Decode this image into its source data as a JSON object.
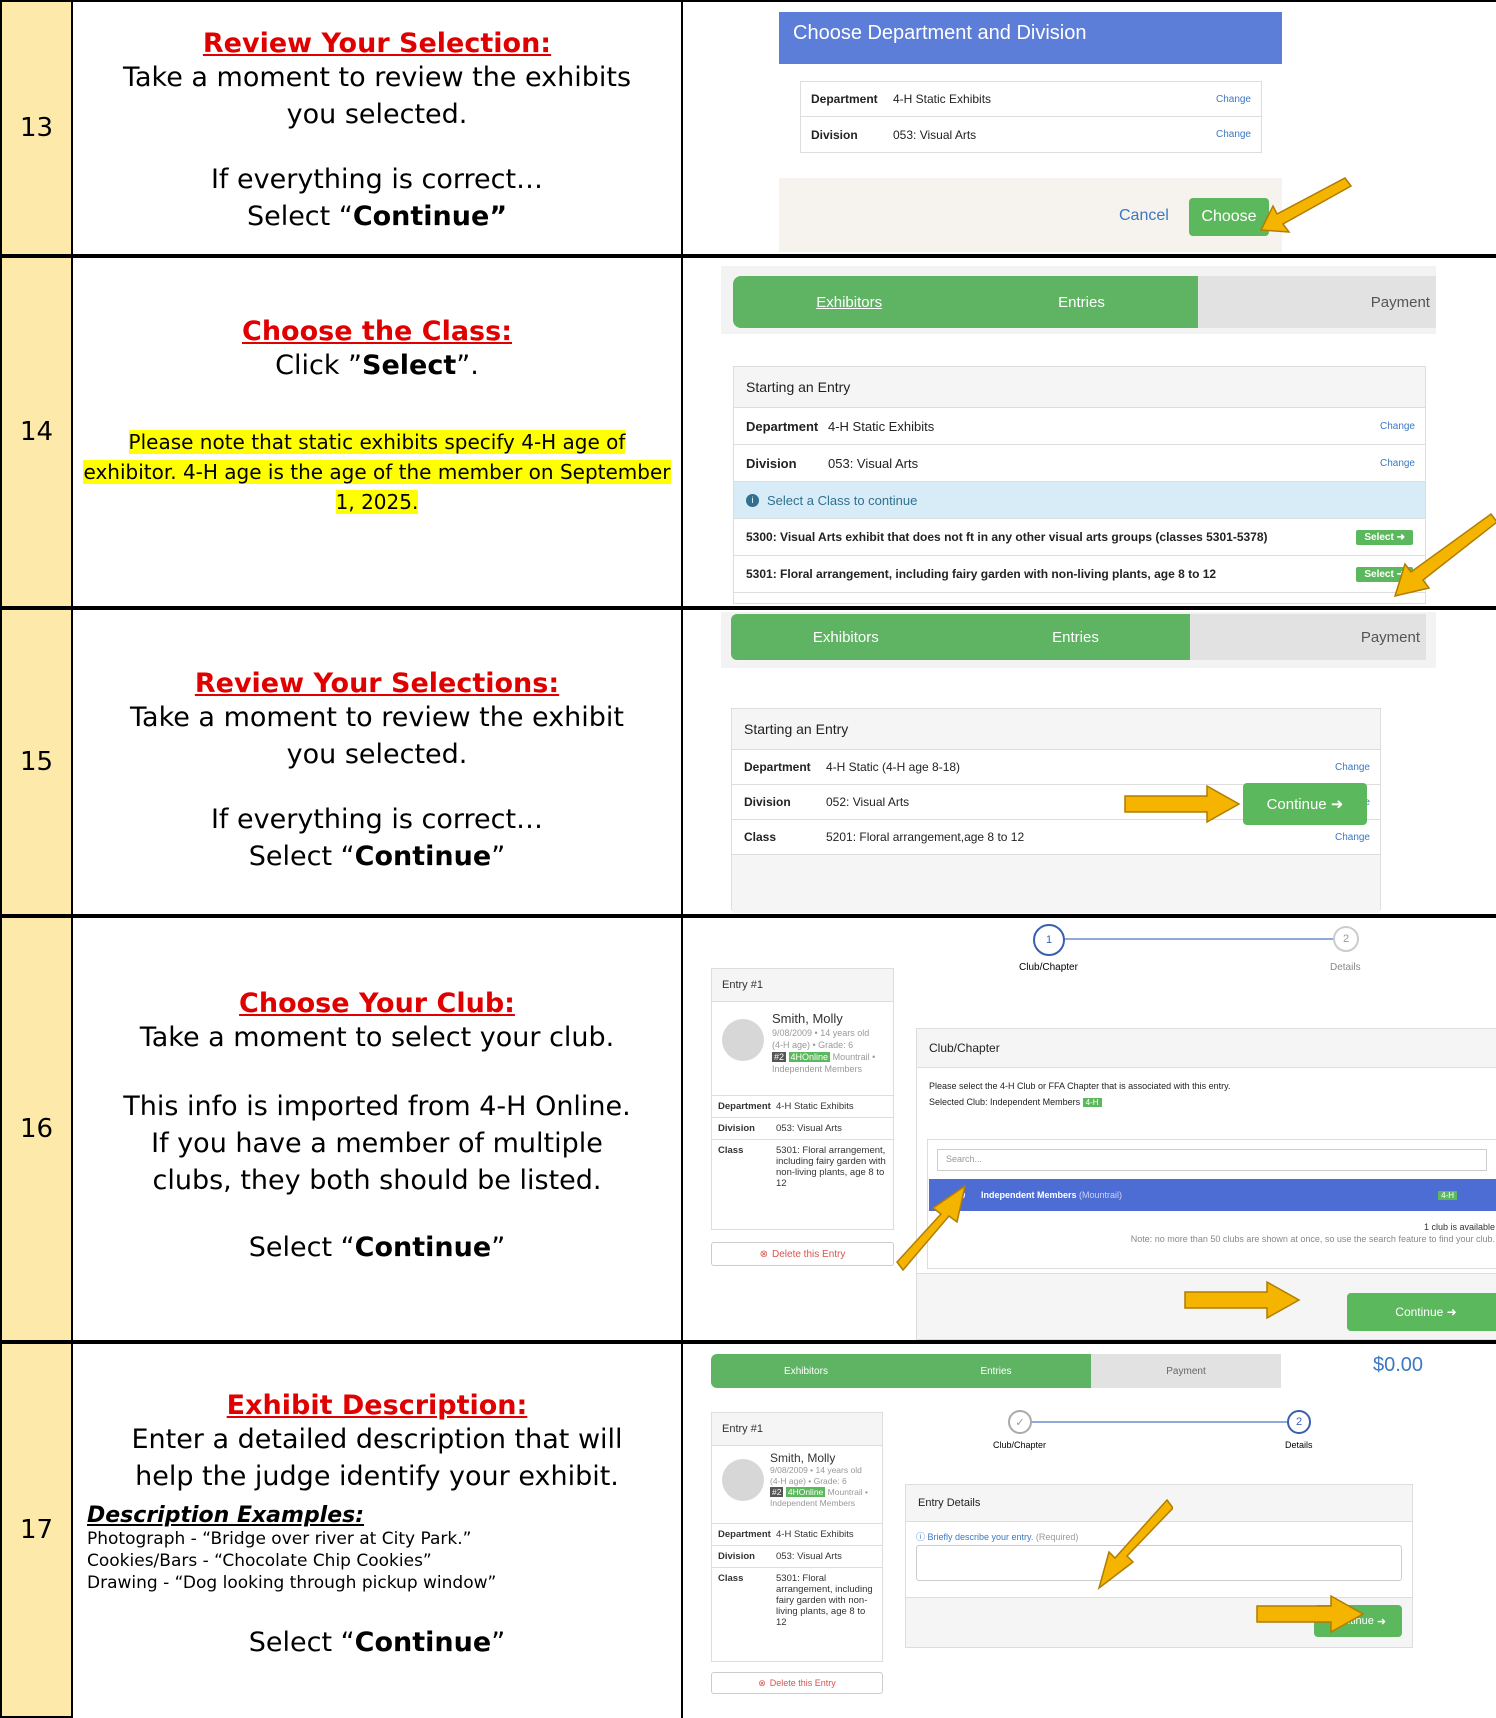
{
  "r13": {
    "num": "13",
    "heading": "Review Your Selection:",
    "l1": "Take a moment to review the exhibits",
    "l2": "you selected.",
    "l3": "If everything is correct…",
    "l4a": "Select “",
    "l4b": "Continue”",
    "ui": {
      "title": "Choose Department and Division",
      "dept_label": "Department",
      "dept_value": "4-H Static Exhibits",
      "div_label": "Division",
      "div_value": "053: Visual Arts",
      "change": "Change",
      "cancel": "Cancel",
      "choose": "Choose"
    }
  },
  "r14": {
    "num": "14",
    "heading": "Choose the Class:",
    "l1a": "Click ”",
    "l1b": "Select",
    "l1c": "”.",
    "note": "Please note that static exhibits specify 4-H age of exhibitor. 4-H age is the age  of the member on September 1, 2025.",
    "ui": {
      "step1": "Exhibitors",
      "step2": "Entries",
      "step3": "Payment",
      "panel_title": "Starting an Entry",
      "dept_label": "Department",
      "dept_value": "4-H Static Exhibits",
      "div_label": "Division",
      "div_value": "053: Visual Arts",
      "change": "Change",
      "info": "Select a Class to continue",
      "class1": "5300: Visual Arts exhibit that does not ft in any other visual arts groups (classes 5301-5378)",
      "class2": "5301: Floral arrangement, including fairy garden with non-living plants, age 8 to 12",
      "select": "Select"
    }
  },
  "r15": {
    "num": "15",
    "heading": "Review Your Selections:",
    "l1": "Take a moment to review the exhibit",
    "l2": "you selected.",
    "l3": "If everything is correct…",
    "l4a": "Select “",
    "l4b": "Continue",
    "l4c": "”",
    "ui": {
      "step1": "Exhibitors",
      "step2": "Entries",
      "step3": "Payment",
      "panel_title": "Starting an Entry",
      "dept_label": "Department",
      "dept_value": "4-H Static (4-H age 8-18)",
      "div_label": "Division",
      "div_value": "052: Visual Arts",
      "class_label": "Class",
      "class_value": "5201: Floral arrangement,age 8 to 12",
      "change": "Change",
      "continue": "Continue"
    }
  },
  "r16": {
    "num": "16",
    "heading": "Choose Your Club:",
    "l1": "Take a moment to select your club.",
    "l2": "This info is imported from 4-H Online.",
    "l3": "If you have a member of multiple",
    "l4": "clubs, they both should be listed.",
    "l5a": "Select “",
    "l5b": "Continue",
    "l5c": "”",
    "ui": {
      "entry": "Entry #1",
      "name": "Smith, Molly",
      "dob": "9/08/2009 • 14 years old",
      "age": "(4-H age) • Grade: 6",
      "badge_num": "#2",
      "badge": "4HOnline",
      "county": "Mountrail •",
      "club": "Independent Members",
      "dept_label": "Department",
      "dept_value": "4-H Static Exhibits",
      "div_label": "Division",
      "div_value": "053: Visual Arts",
      "class_label": "Class",
      "class_value": "5301: Floral arrangement, including fairy garden with non-living plants, age 8 to 12",
      "delete": "Delete this Entry",
      "step1_num": "1",
      "step1": "Club/Chapter",
      "step2_num": "2",
      "step2": "Details",
      "panel_title": "Club/Chapter",
      "prompt": "Please select the 4-H Club or FFA Chapter that is associated with this entry.",
      "selected": "Selected Club: Independent Members",
      "tag": "4-H",
      "search": "Search...",
      "club_row": "Independent Members",
      "club_row_sub": "(Mountrail)",
      "avail": "1 club is available",
      "note": "Note: no more than 50 clubs are shown at once, so use the search feature to find your club.",
      "continue": "Continue"
    }
  },
  "r17": {
    "num": "17",
    "heading": "Exhibit Description:",
    "l1": "Enter a detailed description that will",
    "l2": "help the judge identify your exhibit.",
    "dh": "Description Examples:",
    "e1": "Photograph - “Bridge over river at City Park.”",
    "e2": "Cookies/Bars - “Chocolate Chip Cookies”",
    "e3": "Drawing - “Dog looking through pickup window”",
    "l5a": "Select “",
    "l5b": "Continue",
    "l5c": "”",
    "ui": {
      "step1": "Exhibitors",
      "step2": "Entries",
      "step3": "Payment",
      "total": "$0.00",
      "entry": "Entry #1",
      "name": "Smith, Molly",
      "dob": "9/08/2009 • 14 years old",
      "age": "(4-H age) • Grade: 6",
      "badge_num": "#2",
      "badge": "4HOnline",
      "county": "Mountrail •",
      "club": "Independent Members",
      "dept_label": "Department",
      "dept_value": "4-H Static Exhibits",
      "div_label": "Division",
      "div_value": "053: Visual Arts",
      "class_label": "Class",
      "class_value": "5301: Floral arrangement, including fairy garden with non-living plants, age 8 to 12",
      "delete": "Delete this Entry",
      "s1": "Club/Chapter",
      "s2_num": "2",
      "s2": "Details",
      "panel_title": "Entry Details",
      "describe": "Briefly describe your entry.",
      "required": "(Required)",
      "continue": "Continue"
    }
  }
}
